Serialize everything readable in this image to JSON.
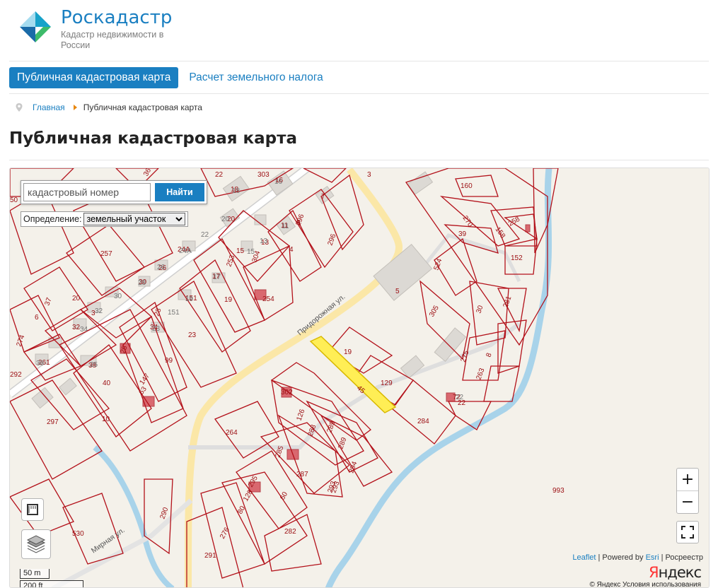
{
  "brand": {
    "title": "Роскадастр",
    "subtitle": "Кадастр недвижимости в России"
  },
  "nav": {
    "tabs": [
      {
        "label": "Публичная кадастровая карта",
        "active": true
      },
      {
        "label": "Расчет земельного налога",
        "active": false
      }
    ]
  },
  "breadcrumb": {
    "home": "Главная",
    "current": "Публичная кадастровая карта"
  },
  "page": {
    "title": "Публичная кадастровая карта"
  },
  "search": {
    "placeholder": "кадастровый номер",
    "button_label": "Найти"
  },
  "definition": {
    "label": "Определение:",
    "selected": "земельный участок"
  },
  "zoom": {
    "in_label": "+",
    "out_label": "−"
  },
  "attribution": {
    "leaflet": "Leaflet",
    "powered_by": "Powered by",
    "esri": "Esri",
    "rosreestr": "Росреестр"
  },
  "yandex": {
    "logo_first": "Я",
    "logo_rest": "ндекс",
    "terms": "© Яндекс  Условия использования"
  },
  "scale": {
    "metric": "50 m",
    "imperial": "200 ft"
  },
  "map_labels": {
    "streets": [
      "Придорожная ул.",
      "Мирная ул."
    ],
    "selected_parcel": "45",
    "parcels": [
      "50",
      "36",
      "22",
      "303",
      "3",
      "160",
      "270",
      "158",
      "258",
      "39",
      "152",
      "524",
      "18",
      "16",
      "7",
      "20",
      "9",
      "296",
      "11",
      "13",
      "4",
      "296",
      "257",
      "24А",
      "15",
      "304",
      "253",
      "17",
      "254",
      "5",
      "305",
      "30",
      "281",
      "37",
      "20",
      "26",
      "30",
      "28",
      "151",
      "19",
      "6",
      "3",
      "32",
      "34",
      "23",
      "8",
      "275",
      "263",
      "274",
      "261",
      "38",
      "25",
      "99",
      "19",
      "129",
      "72",
      "22",
      "292",
      "40",
      "63",
      "147",
      "302",
      "284",
      "297",
      "10",
      "264",
      "126",
      "288",
      "289",
      "289",
      "285",
      "294",
      "287",
      "293",
      "293",
      "993",
      "295",
      "128",
      "80",
      "60",
      "290",
      "530",
      "282",
      "276",
      "291"
    ],
    "buildings": [
      "18",
      "16",
      "20",
      "22",
      "11",
      "13",
      "24А",
      "15",
      "17",
      "26",
      "28",
      "30",
      "32",
      "34",
      "23",
      "25",
      "38",
      "19",
      "151",
      "22"
    ]
  }
}
